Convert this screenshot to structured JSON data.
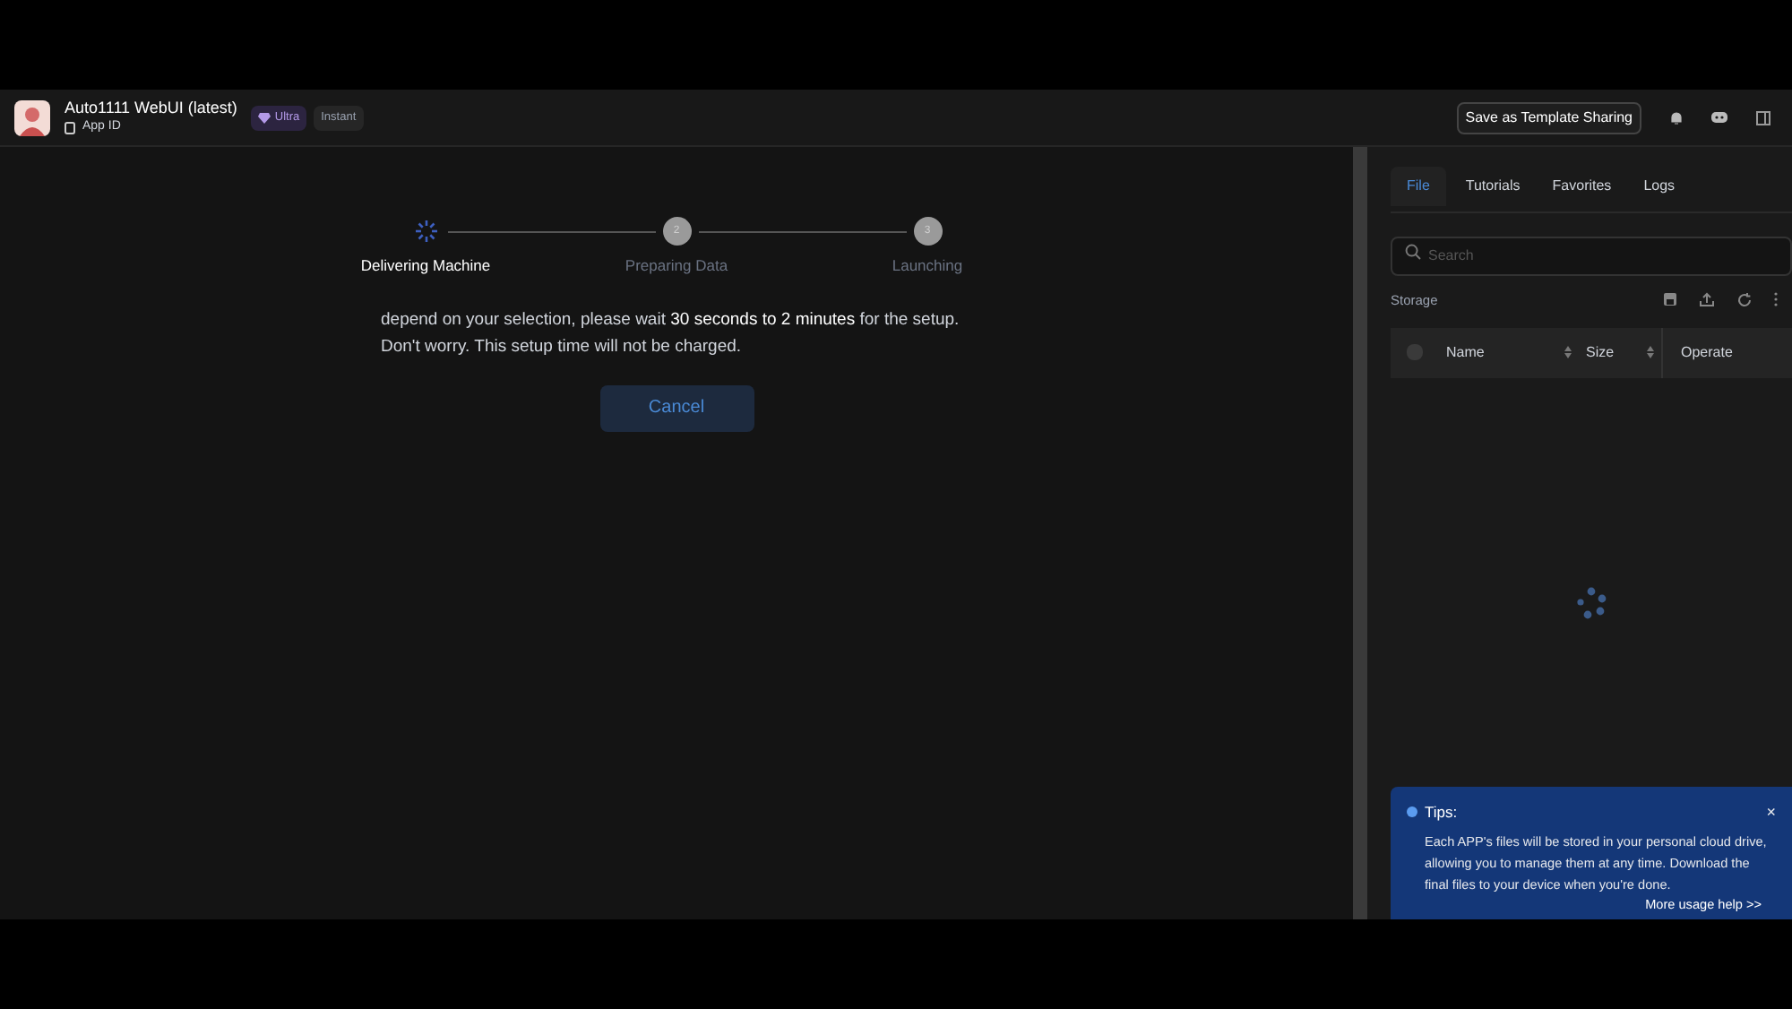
{
  "header": {
    "title": "Auto1111 WebUI (latest)",
    "app_id": "App ID",
    "badges": [
      {
        "kind": "ultra",
        "label": "Ultra"
      },
      {
        "kind": "plain",
        "label": "Instant"
      }
    ],
    "save_button": "Save as Template Sharing"
  },
  "steps": [
    {
      "label": "Delivering Machine",
      "active": true
    },
    {
      "label": "Preparing Data",
      "number": "2",
      "active": false
    },
    {
      "label": "Launching",
      "number": "3",
      "active": false
    }
  ],
  "message": "depend on your selection, please wait **30 seconds to 2 minutes** for the setup.",
  "message_2": "Don't worry. This setup time will not be charged.",
  "cancel_button": "Cancel",
  "panel": {
    "tabs": [
      {
        "label": "File",
        "selected": true
      },
      {
        "label": "Tutorials",
        "selected": false
      },
      {
        "label": "Favorites",
        "selected": false
      },
      {
        "label": "Logs",
        "selected": false
      }
    ],
    "search": {
      "placeholder": "Search"
    },
    "storage_label": "Storage",
    "table": {
      "select_all_checked": false,
      "columns": [
        {
          "label": "Name",
          "sortable": true
        },
        {
          "label": "Size",
          "sortable": true
        },
        {
          "label": "Operate",
          "sortable": false
        }
      ]
    }
  },
  "tips": {
    "title": "Tips:",
    "close": "×",
    "text": "Each APP's files will be stored in your personal cloud drive, allowing you to manage them at any time. Download the final files to your device when you're done.",
    "link": "More usage help >>"
  }
}
